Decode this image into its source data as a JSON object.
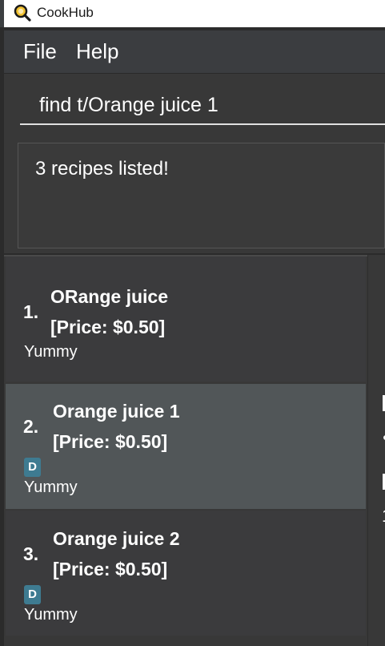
{
  "window": {
    "title": "CookHub",
    "icon": "magnifier-icon"
  },
  "menu": {
    "file": "File",
    "help": "Help"
  },
  "command": {
    "value": "find t/Orange juice 1"
  },
  "result": {
    "text": "3 recipes listed!"
  },
  "recipes": [
    {
      "index": "1.",
      "name": "ORange juice",
      "price": "[Price: $0.50]",
      "tags": [],
      "description": "Yummy"
    },
    {
      "index": "2.",
      "name": "Orange juice 1",
      "price": "[Price: $0.50]",
      "tags": [
        "D"
      ],
      "description": "Yummy",
      "selected": true
    },
    {
      "index": "3.",
      "name": "Orange juice 2",
      "price": "[Price: $0.50]",
      "tags": [
        "D"
      ],
      "description": "Yummy"
    }
  ],
  "detail": {
    "visible_fragment": "1"
  },
  "colors": {
    "selected": "#515658",
    "tag": "#3e7b91",
    "panel": "#383838"
  }
}
